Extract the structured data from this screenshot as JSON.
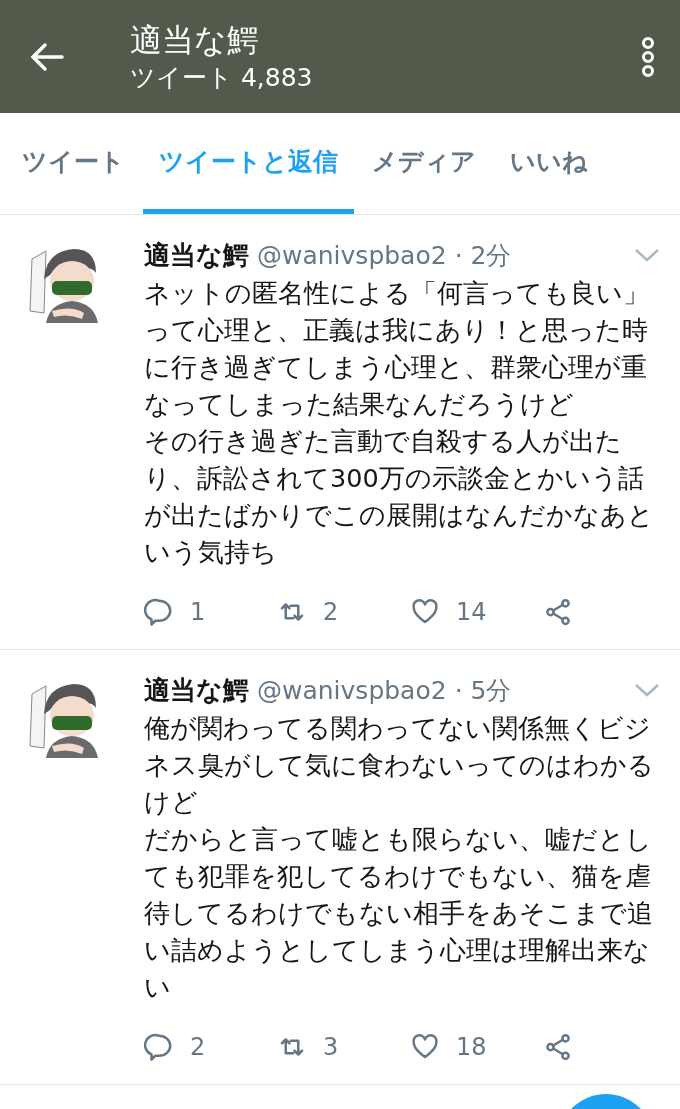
{
  "header": {
    "title": "適当な鰐",
    "subtitle": "ツイート 4,883"
  },
  "tabs": [
    {
      "label": "ツイート",
      "selected": false
    },
    {
      "label": "ツイートと返信",
      "selected": true
    },
    {
      "label": "メディア",
      "selected": false
    },
    {
      "label": "いいね",
      "selected": false
    }
  ],
  "tweets": [
    {
      "name": "適当な鰐",
      "handle": "@wanivspbao2",
      "time": "· 2分",
      "paragraphs": [
        "ネットの匿名性による「何言っても良い」って心理と、正義は我にあり！と思った時に行き過ぎてしまう心理と、群衆心理が重なってしまった結果なんだろうけど",
        "その行き過ぎた言動で自殺する人が出たり、訴訟されて300万の示談金とかいう話が出たばかりでこの展開はなんだかなあという気持ち"
      ],
      "replies": "1",
      "retweets": "2",
      "likes": "14"
    },
    {
      "name": "適当な鰐",
      "handle": "@wanivspbao2",
      "time": "· 5分",
      "paragraphs": [
        "俺が関わってる関わってない関係無くビジネス臭がして気に食わないってのはわかるけど",
        "だからと言って嘘とも限らない、嘘だとしても犯罪を犯してるわけでもない、猫を虐待してるわけでもない相手をあそこまで追い詰めようとしてしまう心理は理解出来ない"
      ],
      "replies": "2",
      "retweets": "3",
      "likes": "18"
    }
  ]
}
